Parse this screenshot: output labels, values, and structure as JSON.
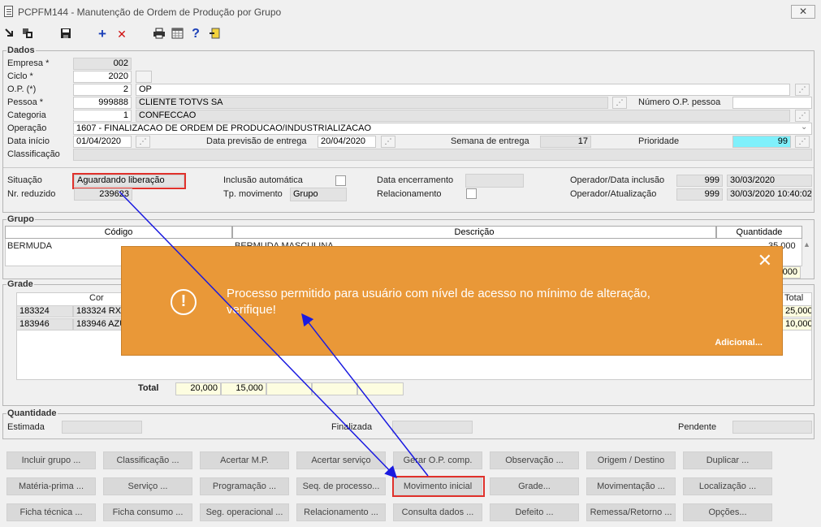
{
  "window": {
    "title": "PCPFM144 - Manutenção de Ordem de Produção por Grupo",
    "close_glyph": "✕"
  },
  "toolbar": {
    "icons": [
      "exit-icon",
      "copy-icon",
      "save-icon",
      "add-icon",
      "delete-icon",
      "print-icon",
      "calendar-icon",
      "help-icon",
      "door-icon"
    ],
    "add_glyph": "+",
    "delete_glyph": "✕",
    "help_glyph": "?"
  },
  "dados": {
    "legend": "Dados",
    "empresa_label": "Empresa *",
    "empresa": "002",
    "ciclo_label": "Ciclo *",
    "ciclo": "2020",
    "op_label": "O.P. (*)",
    "op": "2",
    "op_desc": "OP",
    "pessoa_label": "Pessoa *",
    "pessoa": "999888",
    "pessoa_desc": "CLIENTE TOTVS SA",
    "numero_op_pessoa_label": "Número O.P. pessoa",
    "numero_op_pessoa": "",
    "categoria_label": "Categoria",
    "categoria": "1",
    "categoria_desc": "CONFECCAO",
    "operacao_label": "Operação",
    "operacao": "1607 - FINALIZACAO DE ORDEM DE PRODUCAO/INDUSTRIALIZACAO",
    "data_inicio_label": "Data início",
    "data_inicio": "01/04/2020",
    "data_previsao_label": "Data previsão de entrega",
    "data_previsao": "20/04/2020",
    "semana_label": "Semana de entrega",
    "semana": "17",
    "prioridade_label": "Prioridade",
    "prioridade": "99",
    "classificacao_label": "Classificação",
    "classificacao": ""
  },
  "status": {
    "situacao_label": "Situação",
    "situacao": "Aguardando liberação",
    "nr_reduzido_label": "Nr. reduzido",
    "nr_reduzido": "239623",
    "inclusao_auto_label": "Inclusão automática",
    "tp_movimento_label": "Tp. movimento",
    "tp_movimento": "Grupo",
    "data_encerramento_label": "Data encerramento",
    "data_encerramento": "",
    "relacionamento_label": "Relacionamento",
    "operador_inclusao_label": "Operador/Data inclusão",
    "operador_inclusao": "999",
    "data_inclusao": "30/03/2020",
    "operador_atual_label": "Operador/Atualização",
    "operador_atual": "999",
    "data_atual": "30/03/2020 10:40:02"
  },
  "grupo": {
    "legend": "Grupo",
    "columns": [
      "Código",
      "Descrição",
      "Quantidade"
    ],
    "rows": [
      {
        "codigo": "BERMUDA",
        "descricao": "BERMUDA MASCULINA",
        "quantidade": "35,000"
      }
    ],
    "total_value": "35,000"
  },
  "grade": {
    "legend": "Grade",
    "cor_header": "Cor",
    "total_header": "Total",
    "rows": [
      {
        "code": "183324",
        "cor": "183324 RXO",
        "total": "25,000"
      },
      {
        "code": "183946",
        "cor": "183946 AZUL",
        "total": "10,000"
      }
    ],
    "total_label": "Total",
    "totals": [
      "20,000",
      "15,000",
      "",
      "",
      ""
    ]
  },
  "quantidade": {
    "legend": "Quantidade",
    "estimada_label": "Estimada",
    "estimada": "",
    "finalizada_label": "Finalizada",
    "finalizada": "",
    "pendente_label": "Pendente",
    "pendente": ""
  },
  "buttons": [
    [
      "Incluir grupo ...",
      "Classificação ...",
      "Acertar M.P.",
      "Acertar serviço",
      "Gerar O.P. comp.",
      "Observação ...",
      "Origem / Destino",
      "Duplicar ..."
    ],
    [
      "Matéria-prima ...",
      "Serviço ...",
      "Programação ...",
      "Seq. de processo...",
      "Movimento inicial",
      "Grade...",
      "Movimentação ...",
      "Localização ..."
    ],
    [
      "Ficha técnica ...",
      "Ficha consumo ...",
      "Seg. operacional ...",
      "Relacionamento ...",
      "Consulta dados ...",
      "Defeito ...",
      "Remessa/Retorno ...",
      "Opções..."
    ]
  ],
  "toast": {
    "message": "Processo permitido para usuário com nível de acesso no mínimo de alteração, verifique!",
    "more": "Adicional...",
    "close_glyph": "✕",
    "icon_glyph": "!"
  },
  "colors": {
    "toast_bg": "#e99838",
    "highlight_red": "#e0312b",
    "arrow_blue": "#1a1ae0",
    "priority_cyan": "#7ff0fb"
  }
}
